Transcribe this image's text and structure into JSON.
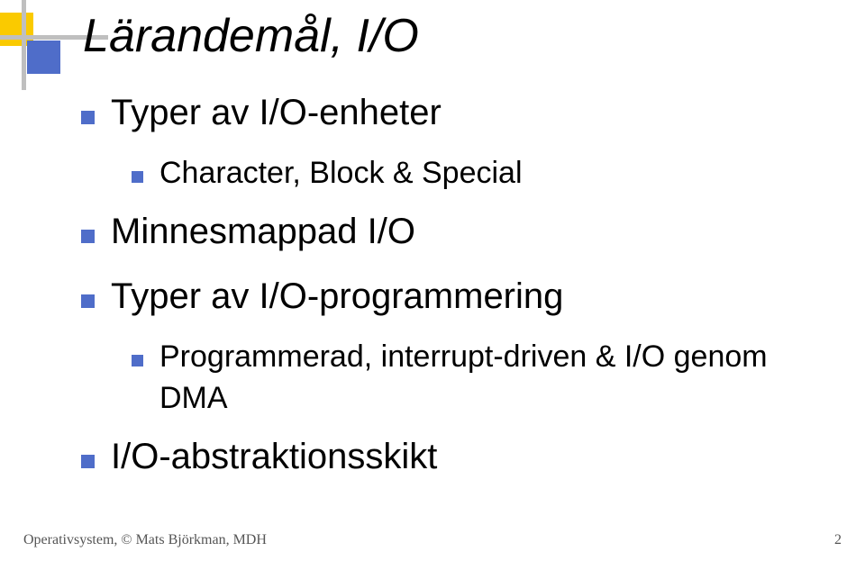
{
  "title": "Lärandemål, I/O",
  "bullets": {
    "b1": "Typer av I/O-enheter",
    "b1a": "Character, Block & Special",
    "b2": "Minnesmappad I/O",
    "b3": "Typer av I/O-programmering",
    "b3a": "Programmerad, interrupt-driven & I/O genom DMA",
    "b4": "I/O-abstraktionsskikt"
  },
  "footer": {
    "left": "Operativsystem, © Mats Björkman, MDH",
    "right": "2"
  }
}
